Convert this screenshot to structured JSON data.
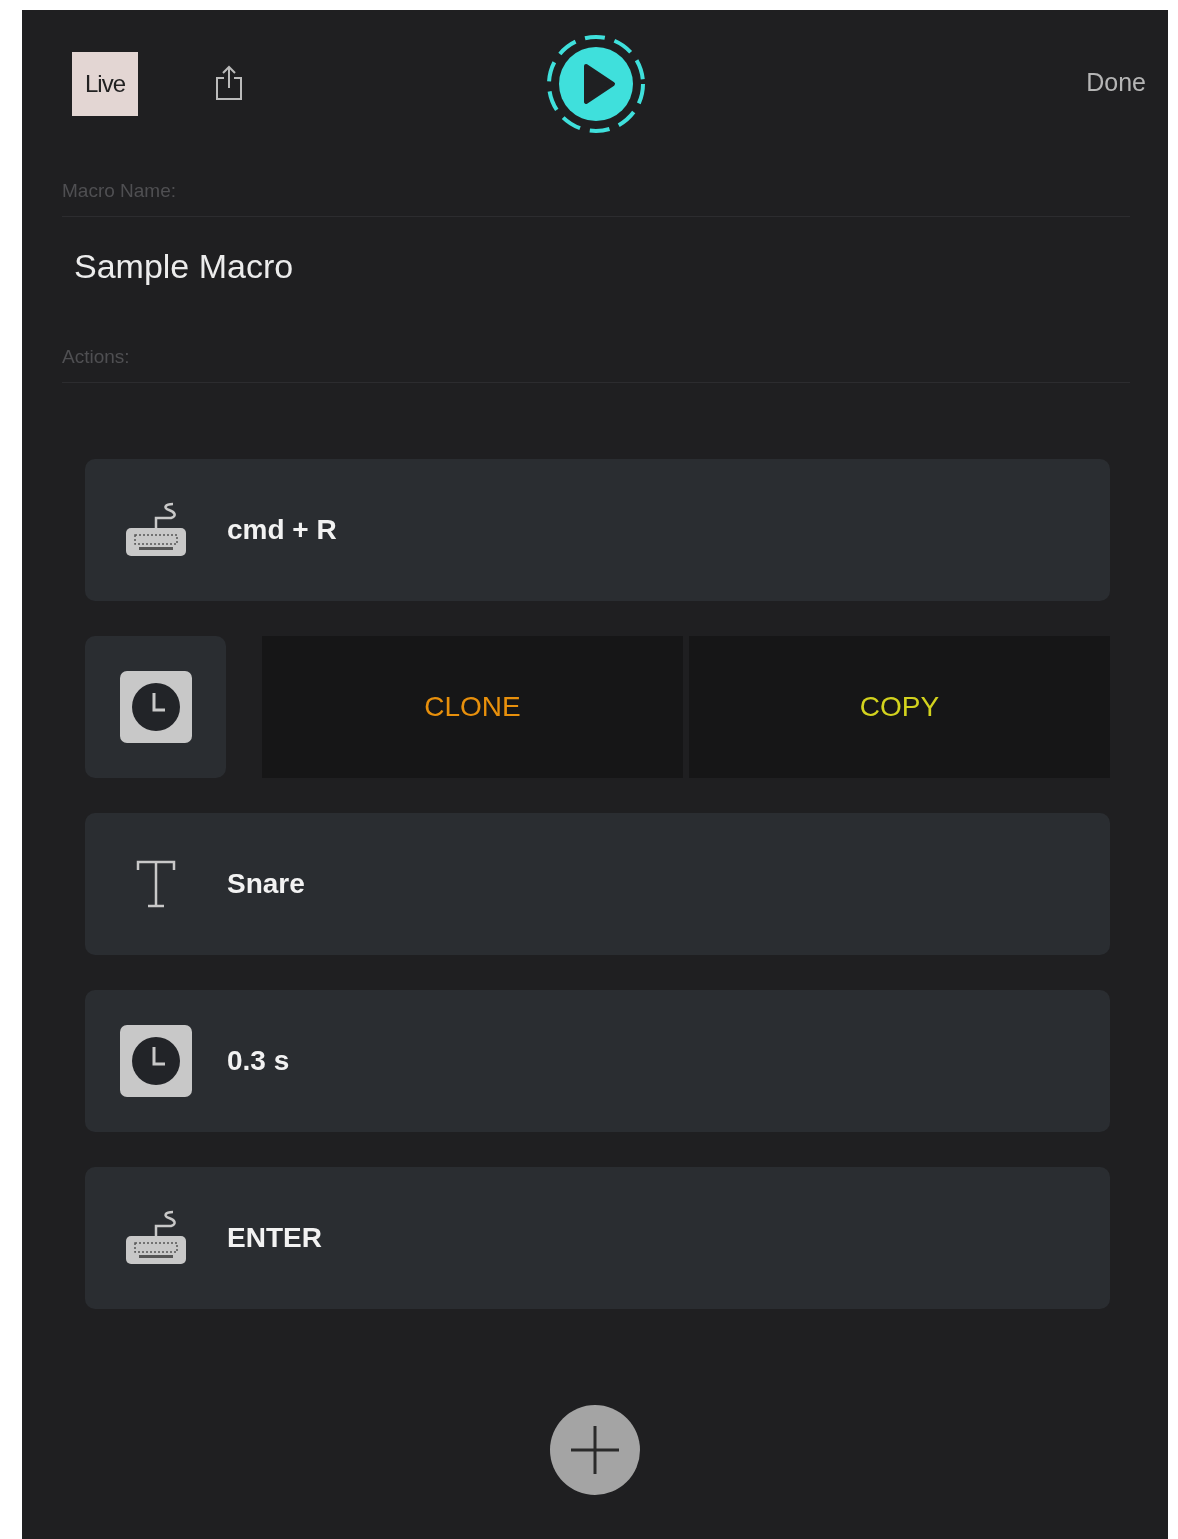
{
  "header": {
    "app_badge": "Live",
    "done": "Done"
  },
  "macro_name": {
    "label": "Macro Name:",
    "value": "Sample Macro"
  },
  "actions_label": "Actions:",
  "actions": [
    {
      "kind": "keyboard",
      "text": "cmd + R"
    },
    {
      "kind": "swiped",
      "buttons": [
        {
          "label": "CLONE",
          "color": "#e8900c"
        },
        {
          "label": "COPY",
          "color": "#d2d21e"
        }
      ]
    },
    {
      "kind": "text",
      "text": "Snare"
    },
    {
      "kind": "delay",
      "text": "0.3 s"
    },
    {
      "kind": "keyboard",
      "text": "ENTER"
    }
  ]
}
